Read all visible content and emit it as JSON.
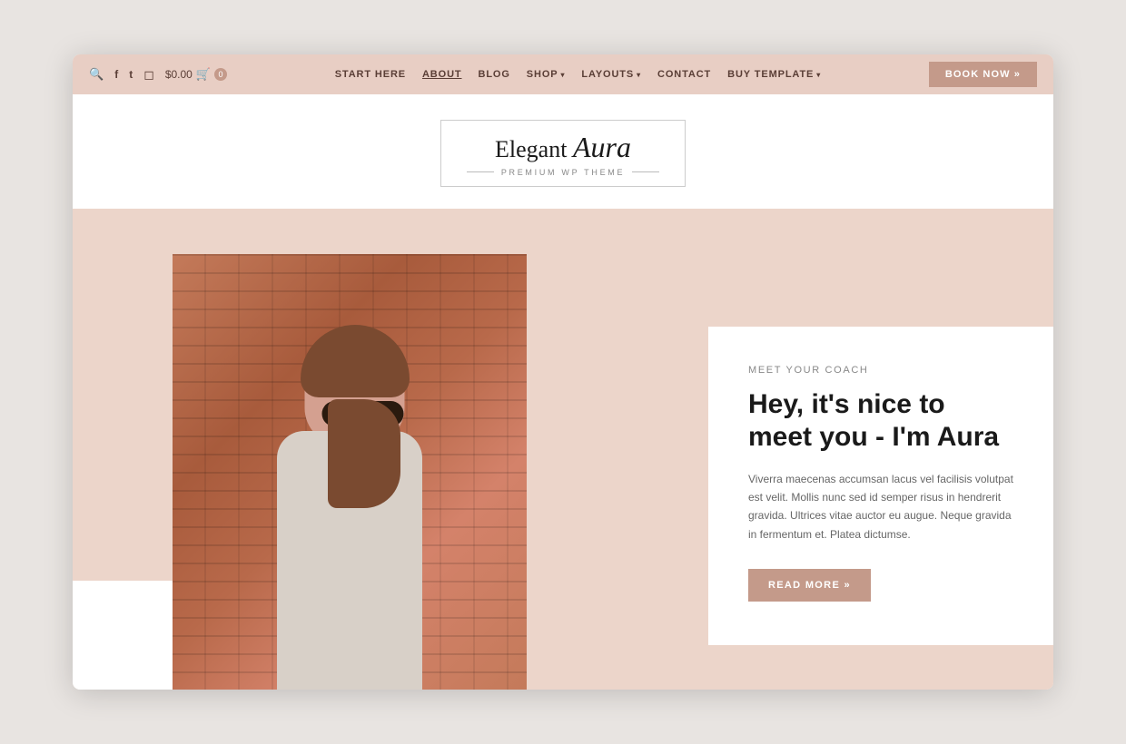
{
  "topbar": {
    "price": "$0.00",
    "cart_count": "0",
    "nav_items": [
      {
        "label": "START HERE",
        "active": false,
        "dropdown": false
      },
      {
        "label": "ABOUT",
        "active": true,
        "dropdown": false
      },
      {
        "label": "BLOG",
        "active": false,
        "dropdown": false
      },
      {
        "label": "SHOP",
        "active": false,
        "dropdown": true
      },
      {
        "label": "LAYOUTS",
        "active": false,
        "dropdown": true
      },
      {
        "label": "CONTACT",
        "active": false,
        "dropdown": false
      },
      {
        "label": "BUY TEMPLATE",
        "active": false,
        "dropdown": true
      }
    ],
    "book_now": "BOOK NOW »"
  },
  "logo": {
    "text": "Elegant",
    "script": "Aura",
    "subtitle": "PREMIUM WP THEME"
  },
  "hero": {
    "meet_label": "MEET YOUR COACH",
    "title": "Hey, it's nice to meet you - I'm Aura",
    "description": "Viverra maecenas accumsan lacus vel facilisis volutpat est velit. Mollis nunc sed id semper risus in hendrerit gravida. Ultrices vitae auctor eu augue. Neque gravida in fermentum et. Platea dictumse.",
    "read_more": "READ MORE »"
  },
  "icons": {
    "search": "🔍",
    "facebook": "f",
    "twitter": "t",
    "instagram": "◻",
    "cart": "🛒",
    "arrow": "»"
  }
}
